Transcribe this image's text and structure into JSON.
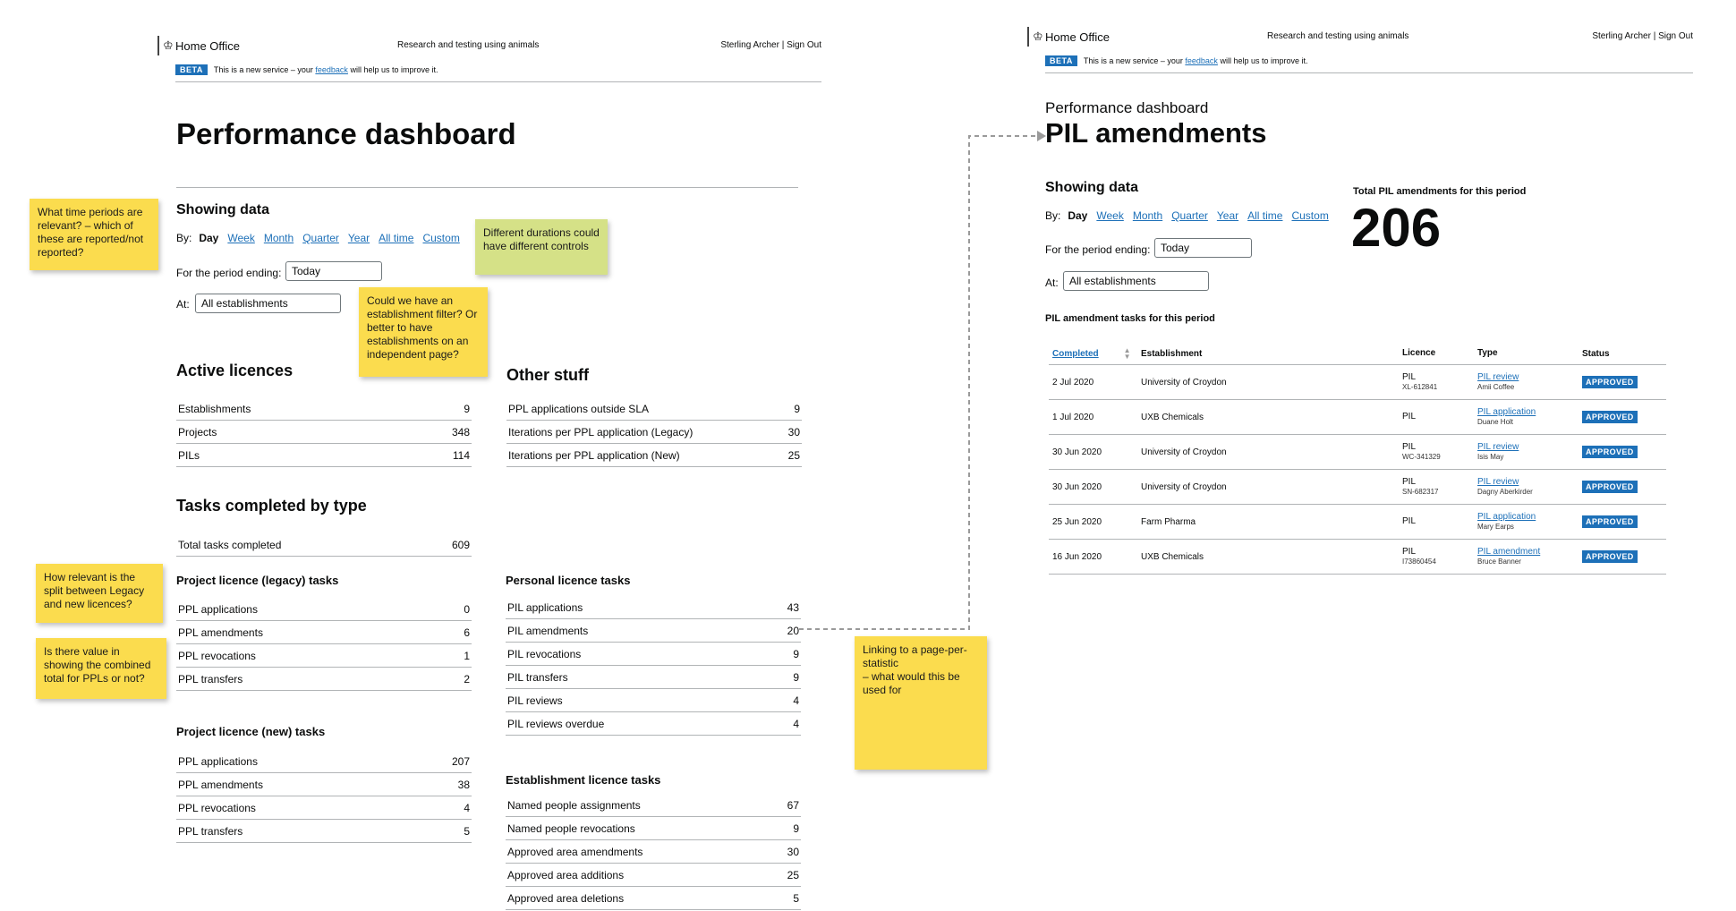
{
  "left_page": {
    "header": {
      "brand": "Home Office",
      "service": "Research and testing using animals",
      "user": "Sterling Archer  |  Sign Out"
    },
    "beta": {
      "tag": "BETA",
      "text_before": "This is a new service – your",
      "feedback_link": "feedback",
      "text_after": "will help us to improve it."
    },
    "title": "Performance dashboard",
    "showing_data": {
      "heading": "Showing data",
      "by_label": "By:",
      "selected": "Day",
      "options": [
        "Week",
        "Month",
        "Quarter",
        "Year",
        "All time",
        "Custom"
      ],
      "period_label": "For the period ending:",
      "period_value": "Today",
      "at_label": "At:",
      "at_value": "All establishments"
    },
    "active_licences": {
      "heading": "Active licences",
      "rows": [
        {
          "label": "Establishments",
          "value": "9"
        },
        {
          "label": "Projects",
          "value": "348"
        },
        {
          "label": "PILs",
          "value": "114"
        }
      ]
    },
    "other_stuff": {
      "heading": "Other stuff",
      "rows": [
        {
          "label": "PPL applications outside SLA",
          "value": "9"
        },
        {
          "label": "Iterations per PPL application (Legacy)",
          "value": "30"
        },
        {
          "label": "Iterations per PPL application (New)",
          "value": "25"
        }
      ]
    },
    "tasks_by_type": {
      "heading": "Tasks completed by type",
      "total": {
        "label": "Total tasks completed",
        "value": "609"
      }
    },
    "project_legacy": {
      "heading": "Project licence (legacy) tasks",
      "rows": [
        {
          "label": "PPL applications",
          "value": "0"
        },
        {
          "label": "PPL amendments",
          "value": "6"
        },
        {
          "label": "PPL revocations",
          "value": "1"
        },
        {
          "label": "PPL transfers",
          "value": "2"
        }
      ]
    },
    "project_new": {
      "heading": "Project licence (new) tasks",
      "rows": [
        {
          "label": "PPL applications",
          "value": "207"
        },
        {
          "label": "PPL amendments",
          "value": "38"
        },
        {
          "label": "PPL revocations",
          "value": "4"
        },
        {
          "label": "PPL transfers",
          "value": "5"
        }
      ]
    },
    "personal": {
      "heading": "Personal licence tasks",
      "rows": [
        {
          "label": "PIL applications",
          "value": "43"
        },
        {
          "label": "PIL amendments",
          "value": "20"
        },
        {
          "label": "PIL revocations",
          "value": "9"
        },
        {
          "label": "PIL transfers",
          "value": "9"
        },
        {
          "label": "PIL reviews",
          "value": "4"
        },
        {
          "label": "PIL reviews overdue",
          "value": "4"
        }
      ]
    },
    "establishment": {
      "heading": "Establishment licence tasks",
      "rows": [
        {
          "label": "Named people assignments",
          "value": "67"
        },
        {
          "label": "Named people revocations",
          "value": "9"
        },
        {
          "label": "Approved area amendments",
          "value": "30"
        },
        {
          "label": "Approved area additions",
          "value": "25"
        },
        {
          "label": "Approved area deletions",
          "value": "5"
        }
      ]
    }
  },
  "stickies": {
    "time_periods": "What time periods are relevant?\n– which of these are reported/not reported?",
    "durations": "Different durations could have different controls",
    "establishment_filter": "Could we have an establishment filter? Or better to have establishments on an independent page?",
    "legacy_split": "How relevant is the split between Legacy and new licences?",
    "combined_total": "Is there value in showing the combined total for PPLs or not?",
    "linking": "Linking to a page-per-statistic\n– what would this be used for"
  },
  "right_page": {
    "header": {
      "brand": "Home Office",
      "service": "Research and testing using animals",
      "user": "Sterling Archer  |  Sign Out"
    },
    "beta": {
      "tag": "BETA",
      "text_before": "This is a new service – your",
      "feedback_link": "feedback",
      "text_after": "will help us to improve it."
    },
    "caption": "Performance dashboard",
    "title": "PIL amendments",
    "showing_data": {
      "heading": "Showing data",
      "by_label": "By:",
      "selected": "Day",
      "options": [
        "Week",
        "Month",
        "Quarter",
        "Year",
        "All time",
        "Custom"
      ],
      "period_label": "For the period ending:",
      "period_value": "Today",
      "at_label": "At:",
      "at_value": "All establishments"
    },
    "total": {
      "label": "Total PIL amendments for this period",
      "value": "206"
    },
    "tasks_heading": "PIL amendment tasks for this period",
    "table": {
      "headers": [
        "Completed",
        "Establishment",
        "Licence",
        "Type",
        "Status"
      ],
      "rows": [
        {
          "date": "2 Jul 2020",
          "establishment": "University of Croydon",
          "licence": "PIL",
          "licence_no": "XL-612841",
          "type": "PIL review",
          "person": "Amii Coffee",
          "status": "APPROVED"
        },
        {
          "date": "1 Jul 2020",
          "establishment": "UXB Chemicals",
          "licence": "PIL",
          "licence_no": "",
          "type": "PIL application",
          "person": "Duane Holt",
          "status": "APPROVED"
        },
        {
          "date": "30 Jun 2020",
          "establishment": "University of Croydon",
          "licence": "PIL",
          "licence_no": "WC-341329",
          "type": "PIL review",
          "person": "Isis May",
          "status": "APPROVED"
        },
        {
          "date": "30 Jun 2020",
          "establishment": "University of Croydon",
          "licence": "PIL",
          "licence_no": "SN-682317",
          "type": "PIL review",
          "person": "Dagny Aberkirder",
          "status": "APPROVED"
        },
        {
          "date": "25 Jun 2020",
          "establishment": "Farm Pharma",
          "licence": "PIL",
          "licence_no": "",
          "type": "PIL application",
          "person": "Mary Earps",
          "status": "APPROVED"
        },
        {
          "date": "16 Jun 2020",
          "establishment": "UXB Chemicals",
          "licence": "PIL",
          "licence_no": "I73860454",
          "type": "PIL amendment",
          "person": "Bruce Banner",
          "status": "APPROVED"
        }
      ]
    }
  }
}
